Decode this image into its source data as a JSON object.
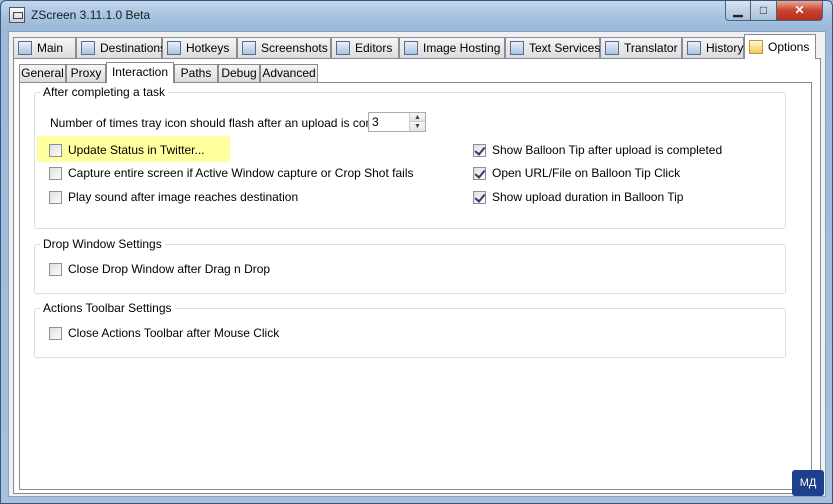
{
  "window": {
    "title": "ZScreen 3.11.1.0 Beta",
    "min_glyph": "▁",
    "max_glyph": "□",
    "close_glyph": "✕"
  },
  "main_tabs": [
    {
      "label": "Main",
      "icon": "main-icon"
    },
    {
      "label": "Destinations",
      "icon": "destinations-icon"
    },
    {
      "label": "Hotkeys",
      "icon": "keyboard-icon"
    },
    {
      "label": "Screenshots",
      "icon": "screenshots-icon"
    },
    {
      "label": "Editors",
      "icon": "editors-icon"
    },
    {
      "label": "Image Hosting",
      "icon": "image-hosting-icon"
    },
    {
      "label": "Text Services",
      "icon": "text-services-icon"
    },
    {
      "label": "Translator",
      "icon": "translator-icon"
    },
    {
      "label": "History",
      "icon": "history-icon"
    },
    {
      "label": "Options",
      "icon": "options-icon",
      "active": true
    }
  ],
  "sub_tabs": [
    {
      "label": "General"
    },
    {
      "label": "Proxy"
    },
    {
      "label": "Interaction",
      "active": true
    },
    {
      "label": "Paths"
    },
    {
      "label": "Debug"
    },
    {
      "label": "Advanced"
    }
  ],
  "after_upload": {
    "title": "After completing a task",
    "flash_label": "Number of times tray icon should flash after an upload is complete",
    "flash_value": "3",
    "twitter": {
      "label": "Update Status in Twitter...",
      "checked": false
    },
    "capture_entire": {
      "label": "Capture entire screen if Active Window capture or Crop Shot fails",
      "checked": false
    },
    "play_sound": {
      "label": "Play sound after image reaches destination",
      "checked": false
    },
    "balloon_tip": {
      "label": "Show Balloon Tip after upload is completed",
      "checked": true
    },
    "open_url": {
      "label": "Open URL/File on Balloon Tip Click",
      "checked": true
    },
    "upload_duration": {
      "label": "Show upload duration in Balloon Tip",
      "checked": true
    }
  },
  "drop_window": {
    "title": "Drop Window Settings",
    "close_after_drag": {
      "label": "Close Drop Window after Drag n Drop",
      "checked": false
    }
  },
  "actions_toolbar": {
    "title": "Actions Toolbar Settings",
    "close_after_click": {
      "label": "Close Actions Toolbar after Mouse Click",
      "checked": false
    }
  },
  "taskbar_badge": {
    "label": "МД"
  },
  "colors": {
    "highlight": "#ffff9e",
    "title_close": "#c7432c",
    "badge": "#1e3f8c"
  }
}
